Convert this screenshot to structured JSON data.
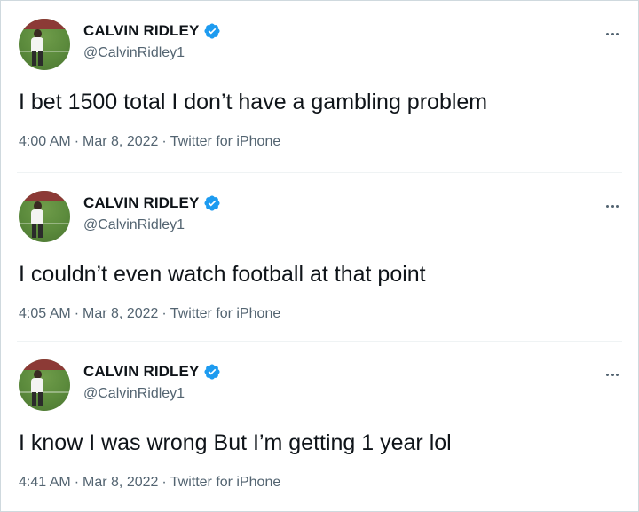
{
  "tweets": [
    {
      "name": "CALVIN RIDLEY",
      "handle": "@CalvinRidley1",
      "text": "I bet 1500 total I don’t have a gambling problem",
      "time": "4:00 AM",
      "date": "Mar 8, 2022",
      "source": "Twitter for iPhone"
    },
    {
      "name": "CALVIN RIDLEY",
      "handle": "@CalvinRidley1",
      "text": "I couldn’t even watch football at that point",
      "time": "4:05 AM",
      "date": "Mar 8, 2022",
      "source": "Twitter for iPhone"
    },
    {
      "name": "CALVIN RIDLEY",
      "handle": "@CalvinRidley1",
      "text": "I know I was wrong But I’m getting 1 year lol",
      "time": "4:41 AM",
      "date": "Mar 8, 2022",
      "source": "Twitter for iPhone"
    }
  ],
  "separator": "·",
  "icons": {
    "verified": "verified-badge-icon",
    "more": "more-options-icon",
    "avatar": "profile-avatar"
  },
  "colors": {
    "verified_blue": "#1d9bf0",
    "text_primary": "#0f1419",
    "text_secondary": "#536471",
    "border": "#cfd9de"
  }
}
